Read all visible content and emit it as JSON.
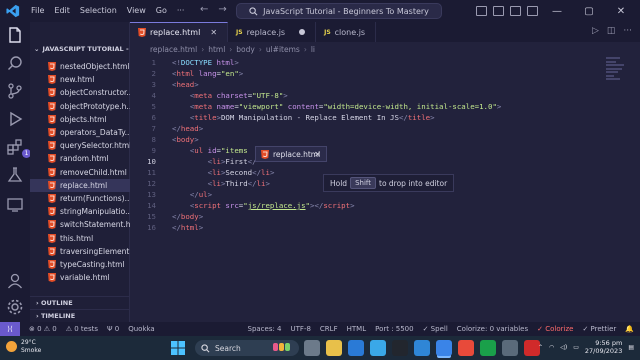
{
  "titlebar": {
    "menu": [
      "File",
      "Edit",
      "Selection",
      "View",
      "Go"
    ],
    "command_center": "JavaScript Tutorial - Beginners To Mastery"
  },
  "activity": {
    "extensions_badge": "1"
  },
  "sidebar": {
    "header": "JAVASCRIPT TUTORIAL - B...",
    "files": [
      {
        "name": "nestedObject.html",
        "active": false
      },
      {
        "name": "new.html",
        "active": false
      },
      {
        "name": "objectConstructor....",
        "active": false
      },
      {
        "name": "objectPrototype.h...",
        "active": false
      },
      {
        "name": "objects.html",
        "active": false
      },
      {
        "name": "operators_DataTy...",
        "active": false
      },
      {
        "name": "querySelector.html",
        "active": false
      },
      {
        "name": "random.html",
        "active": false
      },
      {
        "name": "removeChild.html",
        "active": false
      },
      {
        "name": "replace.html",
        "active": true
      },
      {
        "name": "return(Functions)....",
        "active": false
      },
      {
        "name": "stringManipulatio...",
        "active": false
      },
      {
        "name": "switchStatement.h...",
        "active": false
      },
      {
        "name": "this.html",
        "active": false
      },
      {
        "name": "traversingElement....",
        "active": false
      },
      {
        "name": "typeCasting.html",
        "active": false
      },
      {
        "name": "variable.html",
        "active": false
      }
    ],
    "outline": "OUTLINE",
    "timeline": "TIMELINE"
  },
  "tabs": [
    {
      "label": "replace.html",
      "type": "html",
      "active": true
    },
    {
      "label": "replace.js",
      "type": "js",
      "active": false,
      "modified": true
    },
    {
      "label": "clone.js",
      "type": "js",
      "active": false
    }
  ],
  "breadcrumb": [
    "replace.html",
    "html",
    "body",
    "ul#items",
    "li"
  ],
  "editor": {
    "current_line": 10,
    "lines": [
      {
        "n": "1",
        "html": "<span class='t-br'>&lt;!</span><span class='t-dt'>DOCTYPE</span><span class='t-txt'> </span><span class='t-attr'>html</span><span class='t-br'>&gt;</span>"
      },
      {
        "n": "2",
        "html": "<span class='t-br'>&lt;</span><span class='t-tag'>html</span> <span class='t-attr'>lang</span><span class='t-txt'>=</span><span class='t-str'>\"en\"</span><span class='t-br'>&gt;</span>"
      },
      {
        "n": "3",
        "html": "<span class='t-br'>&lt;</span><span class='t-tag'>head</span><span class='t-br'>&gt;</span>"
      },
      {
        "n": "4",
        "html": "    <span class='t-br'>&lt;</span><span class='t-tag'>meta</span> <span class='t-attr'>charset</span><span class='t-txt'>=</span><span class='t-str'>\"UTF-8\"</span><span class='t-br'>&gt;</span>"
      },
      {
        "n": "5",
        "html": "    <span class='t-br'>&lt;</span><span class='t-tag'>meta</span> <span class='t-attr'>name</span><span class='t-txt'>=</span><span class='t-str'>\"viewport\"</span> <span class='t-attr'>content</span><span class='t-txt'>=</span><span class='t-str'>\"width=device-width, initial-scale=1.0\"</span><span class='t-br'>&gt;</span>"
      },
      {
        "n": "6",
        "html": "    <span class='t-br'>&lt;</span><span class='t-tag'>title</span><span class='t-br'>&gt;</span><span class='t-txt'>DOM Manipulation - Replace Element In JS</span><span class='t-br'>&lt;/</span><span class='t-tag'>title</span><span class='t-br'>&gt;</span>"
      },
      {
        "n": "7",
        "html": "<span class='t-br'>&lt;/</span><span class='t-tag'>head</span><span class='t-br'>&gt;</span>"
      },
      {
        "n": "8",
        "html": "<span class='t-br'>&lt;</span><span class='t-tag'>body</span><span class='t-br'>&gt;</span>"
      },
      {
        "n": "9",
        "html": "    <span class='t-br'>&lt;</span><span class='t-tag'>ul</span> <span class='t-attr'>id</span><span class='t-txt'>=</span><span class='t-str'>\"items</span>"
      },
      {
        "n": "10",
        "html": "        <span class='t-br'>&lt;</span><span class='t-tag'>li</span><span class='t-br'>&gt;</span><span class='t-txt'>First</span><span class='t-br'>&lt;/</span>"
      },
      {
        "n": "11",
        "html": "        <span class='t-br'>&lt;</span><span class='t-tag'>li</span><span class='t-br'>&gt;</span><span class='t-txt'>Second</span><span class='t-br'>&lt;/</span><span class='t-tag'>li</span><span class='t-br'>&gt;</span>"
      },
      {
        "n": "12",
        "html": "        <span class='t-br'>&lt;</span><span class='t-tag'>li</span><span class='t-br'>&gt;</span><span class='t-txt'>Third</span><span class='t-br'>&lt;/</span><span class='t-tag'>li</span><span class='t-br'>&gt;</span>"
      },
      {
        "n": "13",
        "html": "    <span class='t-br'>&lt;/</span><span class='t-tag'>ul</span><span class='t-br'>&gt;</span>"
      },
      {
        "n": "14",
        "html": "    <span class='t-br'>&lt;</span><span class='t-tag'>script</span> <span class='t-attr'>src</span><span class='t-txt'>=</span><span class='t-str'>\"<u>js/replace.js</u>\"</span><span class='t-br'>&gt;&lt;/</span><span class='t-tag'>script</span><span class='t-br'>&gt;</span>"
      },
      {
        "n": "15",
        "html": "<span class='t-br'>&lt;/</span><span class='t-tag'>body</span><span class='t-br'>&gt;</span>"
      },
      {
        "n": "16",
        "html": "<span class='t-br'>&lt;/</span><span class='t-tag'>html</span><span class='t-br'>&gt;</span>"
      }
    ]
  },
  "drag": {
    "tab_label": "replace.html",
    "hint_prefix": "Hold",
    "hint_key": "Shift",
    "hint_suffix": "to drop into editor"
  },
  "statusbar": {
    "left": [
      "⊗ 0 ⚠ 0",
      "⚠ 0 tests",
      "Ψ 0",
      "Quokka"
    ],
    "right": [
      "Spaces: 4",
      "UTF-8",
      "CRLF",
      "HTML",
      "Port : 5500",
      "✓ Spell",
      "Colorize: 0 variables",
      "✓ Colorize",
      "✓ Prettier"
    ]
  },
  "taskbar": {
    "temp": "29°C",
    "weather": "Smoke",
    "search": "Search",
    "time": "9:56 pm",
    "date": "27/09/2023"
  },
  "colors": {
    "accent": "#6a5acd",
    "html_icon": "#e44d26",
    "js_icon": "#e8d44d"
  }
}
